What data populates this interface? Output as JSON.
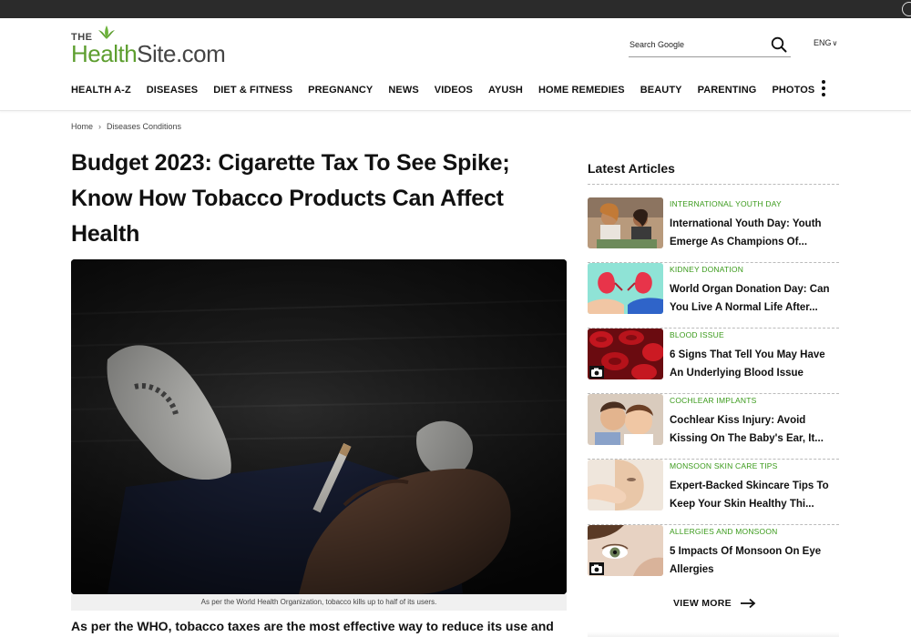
{
  "site": {
    "logo_the": "THE",
    "logo_word1": "Health",
    "logo_word2": "Site.com",
    "brand_green": "#5d9e2f"
  },
  "search": {
    "placeholder": "Search Google"
  },
  "language": {
    "selected": "ENG"
  },
  "nav": {
    "items": [
      "HEALTH A-Z",
      "DISEASES",
      "DIET & FITNESS",
      "PREGNANCY",
      "NEWS",
      "VIDEOS",
      "AYUSH",
      "HOME REMEDIES",
      "BEAUTY",
      "PARENTING",
      "PHOTOS"
    ]
  },
  "breadcrumb": {
    "home": "Home",
    "current": "Diseases Conditions"
  },
  "article": {
    "headline": "Budget 2023: Cigarette Tax To See Spike; Know How Tobacco Products Can Affect Health",
    "image_caption": "As per the World Health Organization, tobacco kills up to half of its users.",
    "lead_text": "As per the WHO, tobacco taxes are the most effective way to reduce its use and"
  },
  "sidebar": {
    "title": "Latest Articles",
    "category_color": "#3a9a1a",
    "articles": [
      {
        "category": "INTERNATIONAL YOUTH DAY",
        "title": "International Youth Day: Youth Emerge As Champions Of...",
        "thumb": "friends-laughing",
        "camera": false
      },
      {
        "category": "KIDNEY DONATION",
        "title": "World Organ Donation Day: Can You Live A Normal Life After...",
        "thumb": "kidney-hands",
        "camera": false
      },
      {
        "category": "BLOOD ISSUE",
        "title": "6 Signs That Tell You May Have An Underlying Blood Issue",
        "thumb": "blood-cells",
        "camera": true
      },
      {
        "category": "COCHLEAR IMPLANTS",
        "title": "Cochlear Kiss Injury: Avoid Kissing On The Baby's Ear, It...",
        "thumb": "parent-kissing-baby",
        "camera": false
      },
      {
        "category": "MONSOON SKIN CARE TIPS",
        "title": "Expert-Backed Skincare Tips To Keep Your Skin Healthy Thi...",
        "thumb": "skincare-face",
        "camera": false
      },
      {
        "category": "ALLERGIES AND MONSOON",
        "title": "5 Impacts Of Monsoon On Eye Allergies",
        "thumb": "eye-closeup",
        "camera": true
      }
    ],
    "view_more": "VIEW MORE"
  }
}
